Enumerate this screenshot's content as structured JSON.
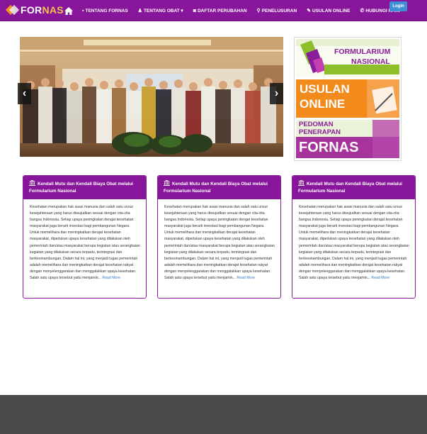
{
  "brand": {
    "name_part1": "FOR",
    "name_part2": "NAS"
  },
  "nav": {
    "home_icon": "home-icon",
    "items": [
      {
        "label": "TENTANG FORNAS",
        "icon": "info-icon"
      },
      {
        "label": "TENTANG OBAT ▾",
        "icon": "user-icon"
      },
      {
        "label": "DAFTAR PERUBAHAN",
        "icon": "camera-icon"
      },
      {
        "label": "PENELUSURAN",
        "icon": "search-icon"
      },
      {
        "label": "USULAN ONLINE",
        "icon": "edit-icon"
      },
      {
        "label": "HUBUNGI KAMI",
        "icon": "phone-icon"
      }
    ],
    "login_label": "Login"
  },
  "carousel": {
    "prev_label": "‹",
    "next_label": "›"
  },
  "banners": [
    {
      "line1": "FORMULARIUM",
      "line2": "NASIONAL"
    },
    {
      "line1": "USULAN",
      "line2": "ONLINE"
    },
    {
      "line1": "PEDOMAN",
      "line2": "PENERAPAN",
      "line3": "FORNAS"
    }
  ],
  "cards": [
    {
      "title": "Kendali Mutu dan Kendali Biaya Obat melalui Formularium Nasional",
      "body": "Kesehatan merupakan hak asasi manusia dan salah satu unsur kesejahteraan yang harus diwujudkan sesuai dengan cita-cita bangsa Indonesia. Setiap upaya peningkatan derajat kesehatan masyarakat juga berarti investasi bagi pembangunan Negara. Untuk memelihara dan meningkatkan derajat kesehatan masyarakat, diperlukan upaya kesehatan yang dilakukan oleh pemerintah dan/atau masyarakat berupa kegiatan atau serangkaian kegiatan yang dilakukan secara terpadu, terintegrasi dan berkesinambungan. Dalam hal ini, yang menjadi tugas pemerintah adalah memelihara dan meningkatkan derajat kesehatan rakyat dengan menyelenggarakan dan menggalakkan upaya kesehatan. Salah satu upaya tersebut yaitu menjamin...",
      "more": "Read More"
    },
    {
      "title": "Kendali Mutu dan Kendali Biaya Obat melalui Formularium Nasional",
      "body": "Kesehatan merupakan hak asasi manusia dan salah satu unsur kesejahteraan yang harus diwujudkan sesuai dengan cita-cita bangsa Indonesia. Setiap upaya peningkatan derajat kesehatan masyarakat juga berarti investasi bagi pembangunan Negara. Untuk memelihara dan meningkatkan derajat kesehatan masyarakat, diperlukan upaya kesehatan yang dilakukan oleh pemerintah dan/atau masyarakat berupa kegiatan atau serangkaian kegiatan yang dilakukan secara terpadu, terintegrasi dan berkesinambungan. Dalam hal ini, yang menjadi tugas pemerintah adalah memelihara dan meningkatkan derajat kesehatan rakyat dengan menyelenggarakan dan menggalakkan upaya kesehatan. Salah satu upaya tersebut yaitu menjamin...",
      "more": "Read More"
    },
    {
      "title": "Kendali Mutu dan Kendali Biaya Obat melalui Formularium Nasional",
      "body": "Kesehatan merupakan hak asasi manusia dan salah satu unsur kesejahteraan yang harus diwujudkan sesuai dengan cita-cita bangsa Indonesia. Setiap upaya peningkatan derajat kesehatan masyarakat juga berarti investasi bagi pembangunan Negara. Untuk memelihara dan meningkatkan derajat kesehatan masyarakat, diperlukan upaya kesehatan yang dilakukan oleh pemerintah dan/atau masyarakat berupa kegiatan atau serangkaian kegiatan yang dilakukan secara terpadu, terintegrasi dan berkesinambungan. Dalam hal ini, yang menjadi tugas pemerintah adalah memelihara dan meningkatkan derajat kesehatan rakyat dengan menyelenggarakan dan menggalakkan upaya kesehatan. Salah satu upaya tersebut yaitu menjamin...",
      "more": "Read More"
    }
  ],
  "colors": {
    "primary": "#88169a",
    "login": "#3f8fd6",
    "footer": "#4a4a4a",
    "link": "#3a76c4"
  }
}
